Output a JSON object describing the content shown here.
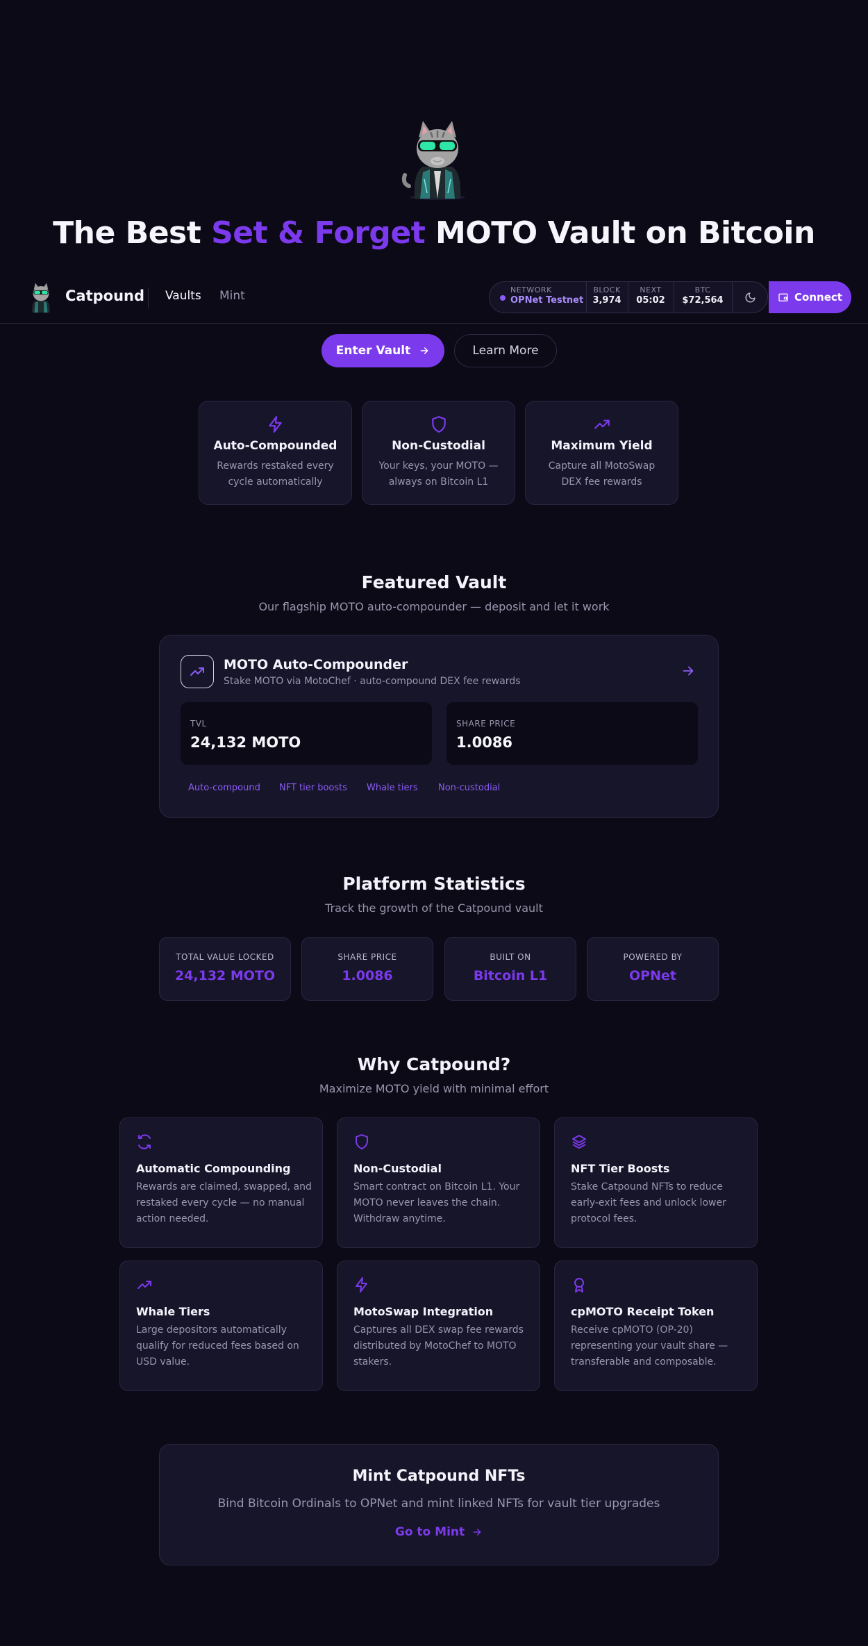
{
  "hero": {
    "title_pre": "The Best ",
    "title_accent": "Set & Forget",
    "title_post": " MOTO Vault on Bitcoin",
    "enter_label": "Enter Vault",
    "learn_label": "Learn More"
  },
  "nav": {
    "brand": "Catpound",
    "links": [
      "Vaults",
      "Mint"
    ],
    "status": {
      "network_label": "NETWORK",
      "network_value": "OPNet Testnet",
      "block_label": "BLOCK",
      "block_value": "3,974",
      "next_label": "NEXT",
      "next_value": "05:02",
      "btc_label": "BTC",
      "btc_value": "$72,564"
    },
    "connect_label": "Connect"
  },
  "features": [
    {
      "icon": "lightning-icon",
      "title": "Auto-Compounded",
      "desc": "Rewards restaked every cycle automatically"
    },
    {
      "icon": "shield-icon",
      "title": "Non-Custodial",
      "desc": "Your keys, your MOTO — always on Bitcoin L1"
    },
    {
      "icon": "trending-up-icon",
      "title": "Maximum Yield",
      "desc": "Capture all MotoSwap DEX fee rewards"
    }
  ],
  "featured": {
    "title": "Featured Vault",
    "subtitle": "Our flagship MOTO auto-compounder — deposit and let it work",
    "vault_name": "MOTO Auto-Compounder",
    "vault_desc": "Stake MOTO via MotoChef · auto-compound DEX fee rewards",
    "tvl_label": "TVL",
    "tvl_value": "24,132 MOTO",
    "share_label": "SHARE PRICE",
    "share_value": "1.0086",
    "tags": [
      "Auto-compound",
      "NFT tier boosts",
      "Whale tiers",
      "Non-custodial"
    ]
  },
  "stats": {
    "title": "Platform Statistics",
    "subtitle": "Track the growth of the Catpound vault",
    "items": [
      {
        "label": "TOTAL VALUE LOCKED",
        "value": "24,132 MOTO"
      },
      {
        "label": "SHARE PRICE",
        "value": "1.0086"
      },
      {
        "label": "BUILT ON",
        "value": "Bitcoin L1"
      },
      {
        "label": "POWERED BY",
        "value": "OPNet"
      }
    ]
  },
  "why": {
    "title": "Why Catpound?",
    "subtitle": "Maximize MOTO yield with minimal effort",
    "items": [
      {
        "icon": "refresh-icon",
        "title": "Automatic Compounding",
        "desc": "Rewards are claimed, swapped, and restaked every cycle — no manual action needed."
      },
      {
        "icon": "shield-icon",
        "title": "Non-Custodial",
        "desc": "Smart contract on Bitcoin L1. Your MOTO never leaves the chain. Withdraw anytime."
      },
      {
        "icon": "layers-icon",
        "title": "NFT Tier Boosts",
        "desc": "Stake Catpound NFTs to reduce early-exit fees and unlock lower protocol fees."
      },
      {
        "icon": "trending-up-icon",
        "title": "Whale Tiers",
        "desc": "Large depositors automatically qualify for reduced fees based on USD value."
      },
      {
        "icon": "lightning-icon",
        "title": "MotoSwap Integration",
        "desc": "Captures all DEX swap fee rewards distributed by MotoChef to MOTO stakers."
      },
      {
        "icon": "award-icon",
        "title": "cpMOTO Receipt Token",
        "desc": "Receive cpMOTO (OP-20) representing your vault share — transferable and composable."
      }
    ]
  },
  "mint": {
    "title": "Mint Catpound NFTs",
    "desc": "Bind Bitcoin Ordinals to OPNet and mint linked NFTs for vault tier upgrades",
    "action": "Go to Mint"
  },
  "colors": {
    "background": "#0c0a17",
    "card": "#17152a",
    "accent": "#7c3aed"
  }
}
